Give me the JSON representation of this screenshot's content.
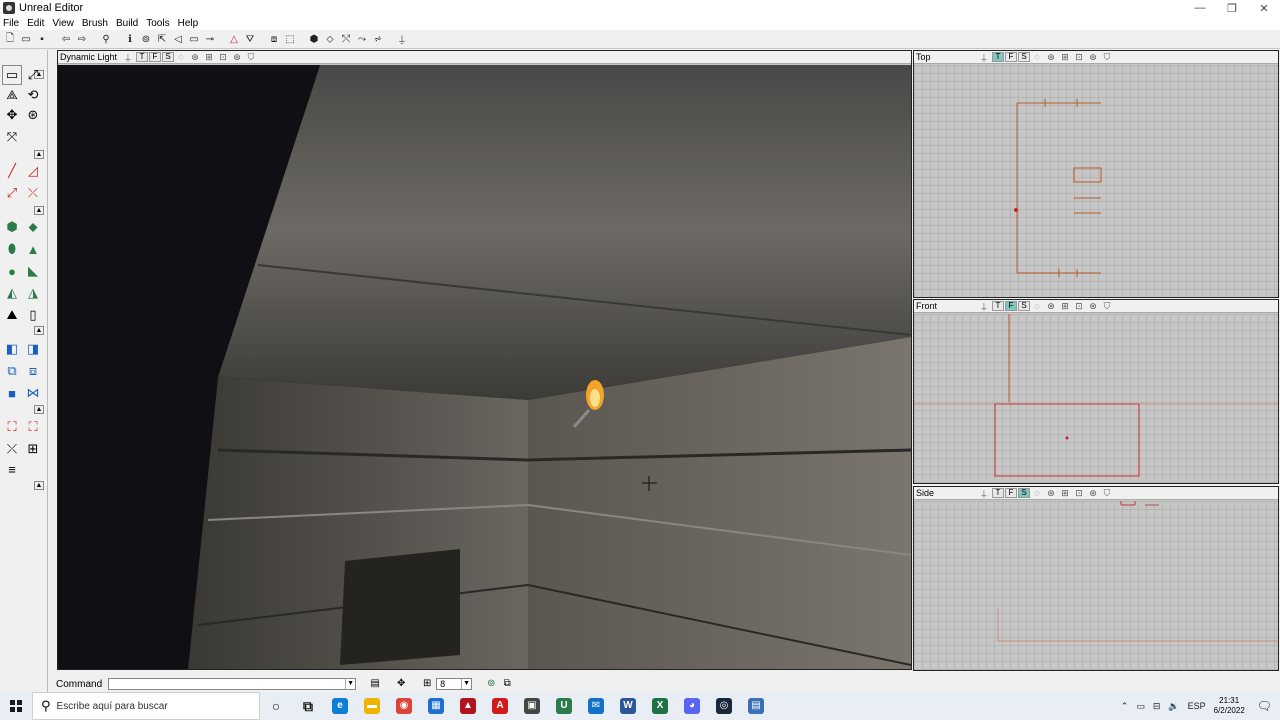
{
  "window": {
    "title": "Unreal Editor",
    "controls": [
      "—",
      "❐",
      "✕"
    ]
  },
  "menu": [
    "File",
    "Edit",
    "View",
    "Brush",
    "Build",
    "Tools",
    "Help"
  ],
  "viewports": {
    "perspective": {
      "mode": "Dynamic Light",
      "buttons": [
        "T",
        "F",
        "S"
      ]
    },
    "top": {
      "title": "Top",
      "buttons": [
        "T",
        "F",
        "S"
      ],
      "active": "T"
    },
    "front": {
      "title": "Front",
      "buttons": [
        "T",
        "F",
        "S"
      ],
      "active": "F"
    },
    "side": {
      "title": "Side",
      "buttons": [
        "T",
        "F",
        "S"
      ],
      "active": "S"
    }
  },
  "command": {
    "label": "Command",
    "value": "",
    "grid_size": "8"
  },
  "taskbar": {
    "search_placeholder": "Escribe aquí para buscar",
    "apps": [
      {
        "name": "cortana",
        "glyph": "○",
        "color": "#1a1a1a"
      },
      {
        "name": "task-view",
        "glyph": "⧉",
        "color": "#1a1a1a"
      },
      {
        "name": "edge",
        "glyph": "e",
        "color": "#0c7ed6"
      },
      {
        "name": "file-explorer",
        "glyph": "▬",
        "color": "#f0b400"
      },
      {
        "name": "chrome",
        "glyph": "◉",
        "color": "#db4437"
      },
      {
        "name": "store",
        "glyph": "▦",
        "color": "#1f6fd0"
      },
      {
        "name": "acrobat",
        "glyph": "▲",
        "color": "#b3131b"
      },
      {
        "name": "autocad",
        "glyph": "A",
        "color": "#d21a1a"
      },
      {
        "name": "game-app",
        "glyph": "▣",
        "color": "#444"
      },
      {
        "name": "unreal-editor",
        "glyph": "U",
        "color": "#2a7a4a"
      },
      {
        "name": "mail",
        "glyph": "✉",
        "color": "#1270c8"
      },
      {
        "name": "word",
        "glyph": "W",
        "color": "#2b5797"
      },
      {
        "name": "excel",
        "glyph": "X",
        "color": "#1f7244"
      },
      {
        "name": "discord",
        "glyph": "◕",
        "color": "#5865f2"
      },
      {
        "name": "steam",
        "glyph": "◎",
        "color": "#1b2838"
      },
      {
        "name": "calculator",
        "glyph": "▤",
        "color": "#3b6fb6"
      }
    ],
    "tray": {
      "language": "ESP",
      "time": "21:31",
      "date": "6/2/2022"
    }
  }
}
